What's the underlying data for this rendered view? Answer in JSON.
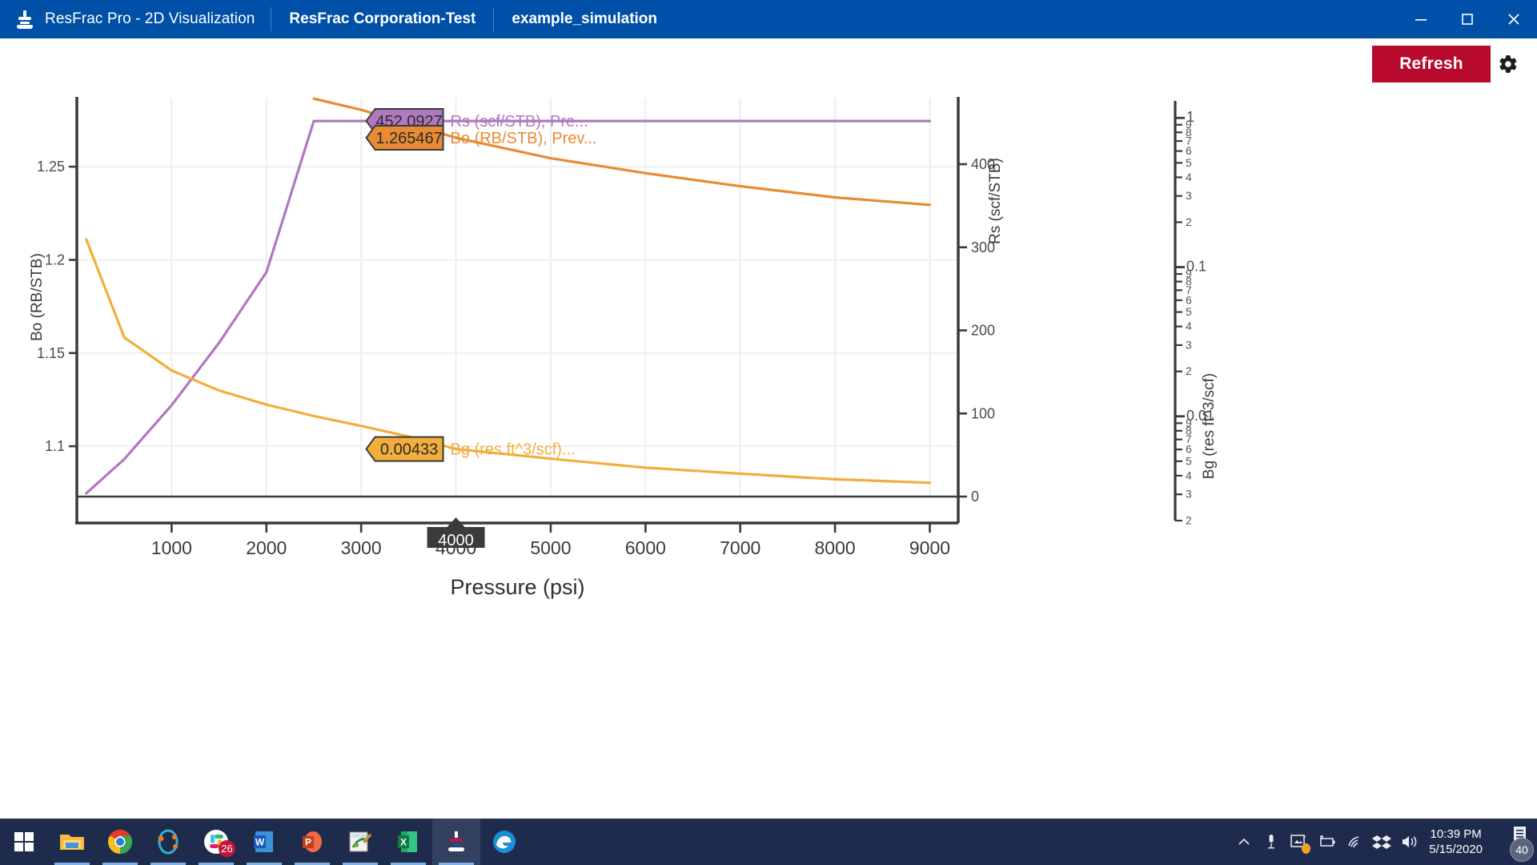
{
  "window": {
    "app_title": "ResFrac Pro - 2D Visualization",
    "app_icon": "resfrac-logo-icon",
    "org_chip": "ResFrac Corporation-Test",
    "sim_chip": "example_simulation",
    "minimize_icon": "minimize-icon",
    "maximize_icon": "maximize-icon",
    "close_icon": "close-icon"
  },
  "toolbar": {
    "refresh_label": "Refresh",
    "settings_icon": "gear-icon"
  },
  "chart_data": {
    "type": "line",
    "title": "",
    "xlabel": "Pressure (psi)",
    "xlim": [
      0,
      9300
    ],
    "xticks": [
      1000,
      2000,
      3000,
      4000,
      5000,
      6000,
      7000,
      8000,
      9000
    ],
    "xtick_labels": [
      "1000",
      "2000",
      "3000",
      "4000",
      "5000",
      "6000",
      "7000",
      "8000",
      "9000"
    ],
    "grid": true,
    "cursor_marker": {
      "label": "4000",
      "x": 4000
    },
    "axes": [
      {
        "id": "left",
        "label": "Bo (RB/STB)",
        "side": "left",
        "scale": "linear",
        "ticks": [
          1.1,
          1.15,
          1.2,
          1.25
        ],
        "tick_labels": [
          "1.1",
          "1.15",
          "1.2",
          "1.25"
        ],
        "lim": [
          1.073,
          1.287
        ]
      },
      {
        "id": "right",
        "label": "Rs (scf/STB)",
        "side": "right",
        "scale": "linear",
        "ticks": [
          0,
          100,
          200,
          300,
          400
        ],
        "tick_labels": [
          "0",
          "100",
          "200",
          "300",
          "400"
        ],
        "lim": [
          0,
          480
        ]
      },
      {
        "id": "far_right",
        "label": "Bg (res ft^3/scf)",
        "side": "far-right",
        "scale": "log",
        "lim": [
          0.002,
          1.3
        ],
        "tick_labels": [
          "1",
          "9",
          "8",
          "7",
          "6",
          "5",
          "4",
          "3",
          "2",
          "0.1",
          "9",
          "8",
          "7",
          "6",
          "5",
          "4",
          "3",
          "2",
          "0.01",
          "9",
          "8",
          "7",
          "6",
          "5",
          "4",
          "3",
          "2"
        ],
        "tick_values": [
          1,
          0.9,
          0.8,
          0.7,
          0.6,
          0.5,
          0.4,
          0.3,
          0.2,
          0.1,
          0.09,
          0.08,
          0.07,
          0.06,
          0.05,
          0.04,
          0.03,
          0.02,
          0.01,
          0.009,
          0.008,
          0.007,
          0.006,
          0.005,
          0.004,
          0.003,
          0.002
        ]
      }
    ],
    "series": [
      {
        "name": "Rs (scf/STB), Pre...",
        "legend_label": "Rs (scf/STB), Pre...",
        "axis": "right",
        "color": "#b078bf",
        "flag_value": "452.0927",
        "flag_x": 4000,
        "x": [
          100,
          500,
          1000,
          1500,
          2000,
          2500,
          3000,
          4000,
          5000,
          6000,
          7000,
          8000,
          9000
        ],
        "y": [
          4,
          45,
          110,
          185,
          270,
          452,
          452,
          452,
          452,
          452,
          452,
          452,
          452
        ]
      },
      {
        "name": "Bo (RB/STB), Prev...",
        "legend_label": "Bo (RB/STB), Prev...",
        "axis": "left",
        "color": "#e88b32",
        "flag_value": "1.265467",
        "flag_x": 4000,
        "x": [
          2500,
          3000,
          4000,
          5000,
          6000,
          7000,
          8000,
          9000
        ],
        "y": [
          1.2865,
          1.2805,
          1.2655,
          1.2545,
          1.2465,
          1.2395,
          1.2335,
          1.2295
        ]
      },
      {
        "name": "Bg (res ft^3/scf)...",
        "legend_label": "Bg (res ft^3/scf)...",
        "axis": "far_right",
        "color": "#f2ae3c",
        "flag_value": "0.00433",
        "flag_x": 4000,
        "x": [
          100,
          500,
          1000,
          1500,
          2000,
          2500,
          3000,
          3500,
          4000,
          5000,
          6000,
          7000,
          8000,
          9000
        ],
        "y": [
          0.13,
          0.0265,
          0.0155,
          0.0112,
          0.0089,
          0.0074,
          0.0063,
          0.0053,
          0.00433,
          0.0037,
          0.0032,
          0.0029,
          0.00265,
          0.0025
        ]
      }
    ]
  },
  "taskbar": {
    "items": [
      {
        "name": "start-button",
        "icon": "windows-logo-icon",
        "label": ""
      },
      {
        "name": "file-explorer",
        "icon": "folder-icon",
        "label": ""
      },
      {
        "name": "google-chrome",
        "icon": "chrome-icon",
        "label": ""
      },
      {
        "name": "orbit-app",
        "icon": "orbit-icon",
        "label": ""
      },
      {
        "name": "slack",
        "icon": "slack-icon",
        "label": "26"
      },
      {
        "name": "microsoft-word",
        "icon": "word-icon",
        "label": "W"
      },
      {
        "name": "microsoft-powerpoint",
        "icon": "powerpoint-icon",
        "label": "P"
      },
      {
        "name": "paint",
        "icon": "paint-icon",
        "label": ""
      },
      {
        "name": "microsoft-excel",
        "icon": "excel-icon",
        "label": "X"
      },
      {
        "name": "resfrac-pro",
        "icon": "resfrac-icon",
        "label": ""
      },
      {
        "name": "microsoft-edge",
        "icon": "edge-icon",
        "label": ""
      }
    ],
    "tray": [
      {
        "name": "show-hidden-icons",
        "icon": "chevron-up-icon"
      },
      {
        "name": "microphone",
        "icon": "microphone-icon"
      },
      {
        "name": "onedrive-sync",
        "icon": "sync-image-icon"
      },
      {
        "name": "battery",
        "icon": "battery-icon"
      },
      {
        "name": "network",
        "icon": "wifi-icon"
      },
      {
        "name": "dropbox",
        "icon": "dropbox-icon"
      },
      {
        "name": "volume",
        "icon": "speaker-icon"
      }
    ],
    "clock_time": "10:39 PM",
    "clock_date": "5/15/2020",
    "notification_count": "40"
  }
}
